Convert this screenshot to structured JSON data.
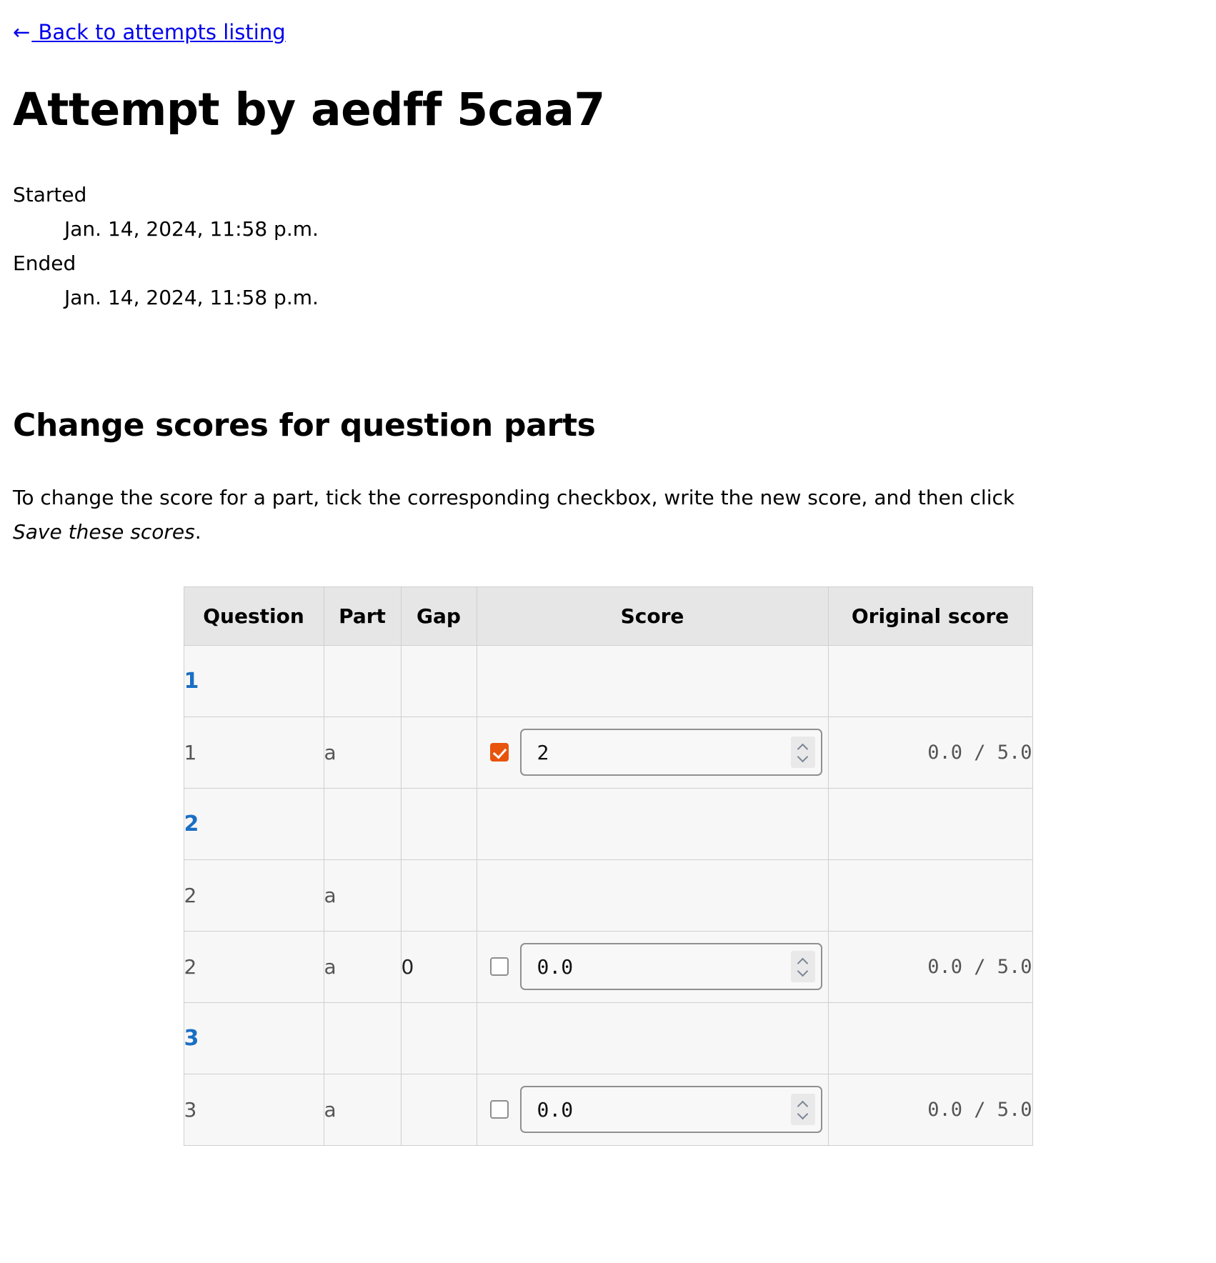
{
  "back": {
    "arrow": "←",
    "label": " Back to attempts listing"
  },
  "title": "Attempt by aedff 5caa7",
  "meta": {
    "started_label": "Started",
    "started_value": "Jan. 14, 2024, 11:58 p.m.",
    "ended_label": "Ended",
    "ended_value": "Jan. 14, 2024, 11:58 p.m."
  },
  "section": {
    "heading": "Change scores for question parts",
    "instructions_prefix": "To change the score for a part, tick the corresponding checkbox, write the new score, and then click ",
    "instructions_italic": "Save these scores",
    "instructions_suffix": "."
  },
  "table": {
    "headers": {
      "question": "Question",
      "part": "Part",
      "gap": "Gap",
      "score": "Score",
      "original": "Original score"
    },
    "rows": [
      {
        "kind": "group",
        "question": "1",
        "part": "",
        "gap": "",
        "has_input": false,
        "checked": false,
        "score_value": "",
        "original": "",
        "highlight": false
      },
      {
        "kind": "part",
        "question": "1",
        "part": "a",
        "gap": "",
        "has_input": true,
        "checked": true,
        "score_value": "2",
        "original": "0.0 / 5.0",
        "highlight": true
      },
      {
        "kind": "group",
        "question": "2",
        "part": "",
        "gap": "",
        "has_input": false,
        "checked": false,
        "score_value": "",
        "original": "",
        "highlight": false
      },
      {
        "kind": "part",
        "question": "2",
        "part": "a",
        "gap": "",
        "has_input": false,
        "checked": false,
        "score_value": "",
        "original": "",
        "highlight": false
      },
      {
        "kind": "part",
        "question": "2",
        "part": "a",
        "gap": "0",
        "has_input": true,
        "checked": false,
        "score_value": "0.0",
        "original": "0.0 / 5.0",
        "highlight": false
      },
      {
        "kind": "group",
        "question": "3",
        "part": "",
        "gap": "",
        "has_input": false,
        "checked": false,
        "score_value": "",
        "original": "",
        "highlight": false
      },
      {
        "kind": "part",
        "question": "3",
        "part": "a",
        "gap": "",
        "has_input": true,
        "checked": false,
        "score_value": "0.0",
        "original": "0.0 / 5.0",
        "highlight": false
      }
    ]
  }
}
